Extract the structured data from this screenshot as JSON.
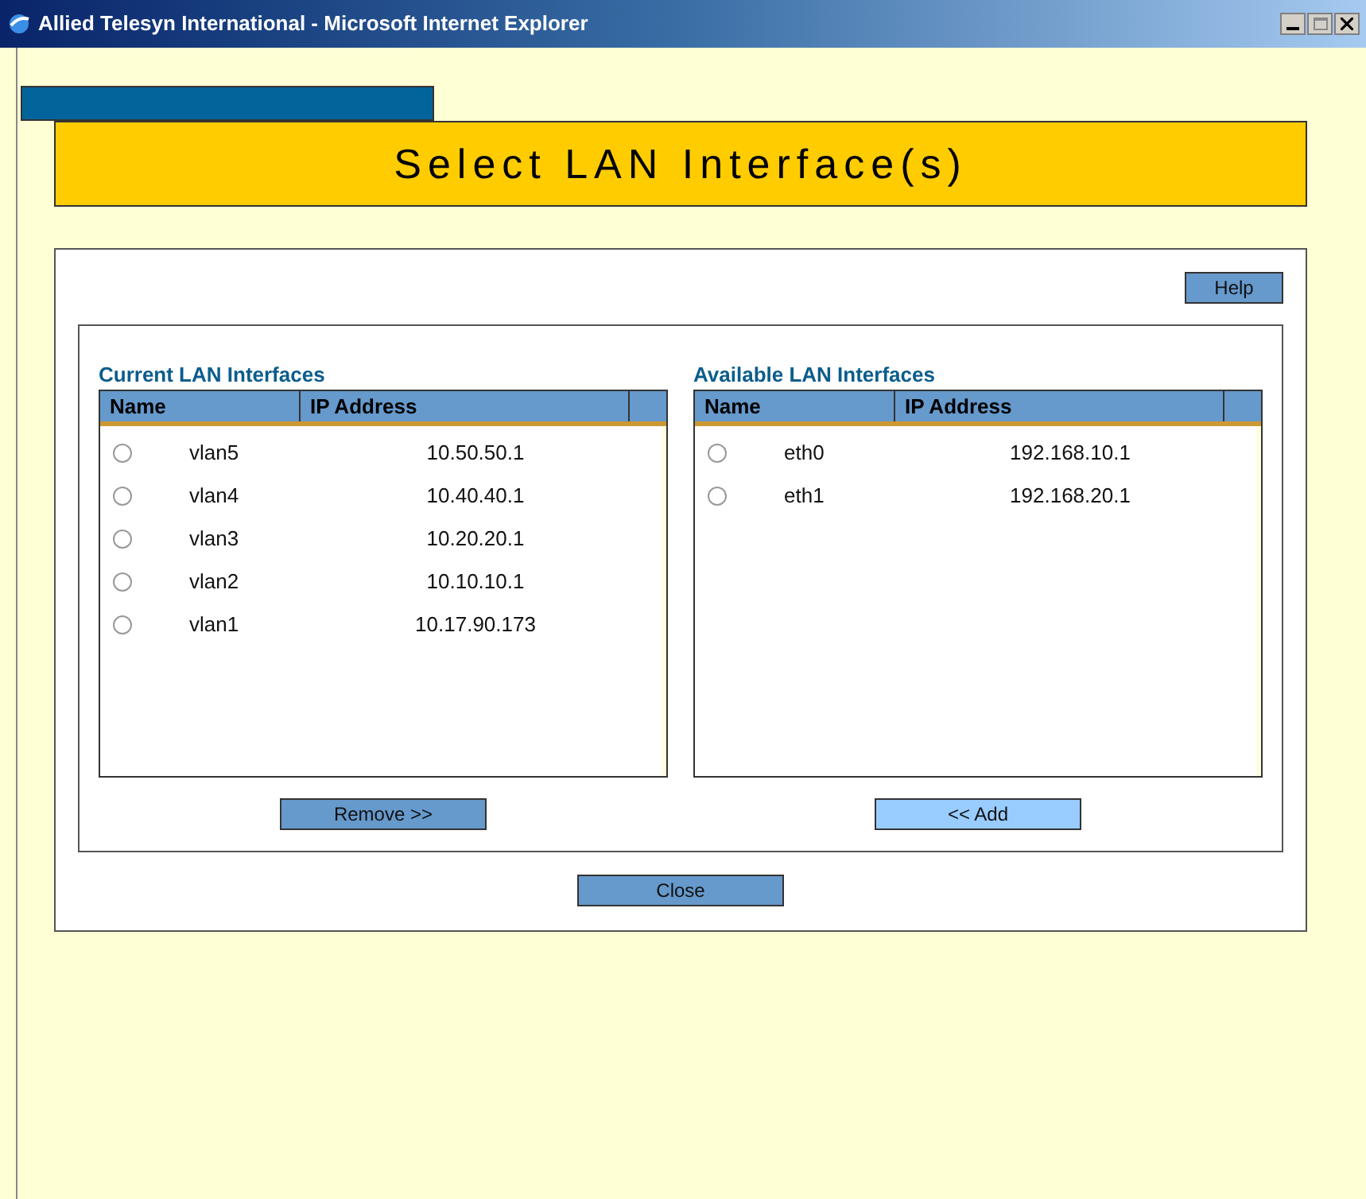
{
  "window": {
    "title": "Allied Telesyn International - Microsoft Internet Explorer"
  },
  "page_title": "Select LAN Interface(s)",
  "help_button": "Help",
  "lists": [
    {
      "title": "Current LAN Interfaces",
      "columns": [
        "Name",
        "IP Address"
      ],
      "rows": [
        {
          "name": "vlan5",
          "ip": "10.50.50.1",
          "selected": false
        },
        {
          "name": "vlan4",
          "ip": "10.40.40.1",
          "selected": false
        },
        {
          "name": "vlan3",
          "ip": "10.20.20.1",
          "selected": false
        },
        {
          "name": "vlan2",
          "ip": "10.10.10.1",
          "selected": false
        },
        {
          "name": "vlan1",
          "ip": "10.17.90.173",
          "selected": false
        }
      ],
      "button": {
        "label": "Remove >>",
        "highlighted": false
      }
    },
    {
      "title": "Available LAN Interfaces",
      "columns": [
        "Name",
        "IP Address"
      ],
      "rows": [
        {
          "name": "eth0",
          "ip": "192.168.10.1",
          "selected": false
        },
        {
          "name": "eth1",
          "ip": "192.168.20.1",
          "selected": false
        }
      ],
      "button": {
        "label": "<< Add",
        "highlighted": true
      }
    }
  ],
  "close_button": "Close"
}
